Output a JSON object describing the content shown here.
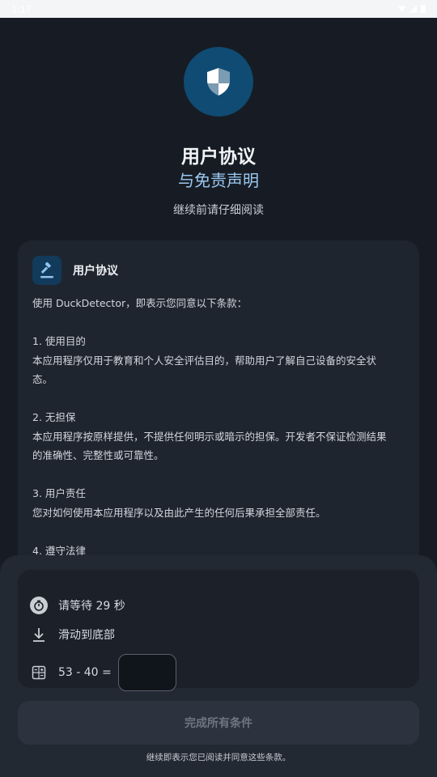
{
  "status_bar": {
    "time": "1:17"
  },
  "header": {
    "title": "用户协议",
    "subtitle": "与免责声明",
    "hint": "继续前请仔细阅读"
  },
  "agreement": {
    "title": "用户协议",
    "intro": "使用 DuckDetector，即表示您同意以下条款：",
    "sections": [
      {
        "heading": "1. 使用目的",
        "text": "本应用程序仅用于教育和个人安全评估目的，帮助用户了解自己设备的安全状",
        "text2": "态。"
      },
      {
        "heading": "2. 无担保",
        "text": "本应用程序按原样提供，不提供任何明示或暗示的担保。开发者不保证检测结果",
        "text2": "的准确性、完整性或可靠性。"
      },
      {
        "heading": "3. 用户责任",
        "text": "您对如何使用本应用程序以及由此产生的任何后果承担全部责任。",
        "text2": ""
      },
      {
        "heading": "4. 遵守法律",
        "text": "",
        "text2": ""
      }
    ]
  },
  "conditions": {
    "wait": "请等待 29 秒",
    "scroll": "滑动到底部",
    "math_question": "53 - 40 =",
    "math_answer": ""
  },
  "actions": {
    "finish_label": "完成所有条件",
    "footer_note": "继续即表示您已阅读并同意这些条款。"
  },
  "colors": {
    "background": "#171c24",
    "accent": "#9cc9f3",
    "shield_circle": "#0f4b73"
  }
}
